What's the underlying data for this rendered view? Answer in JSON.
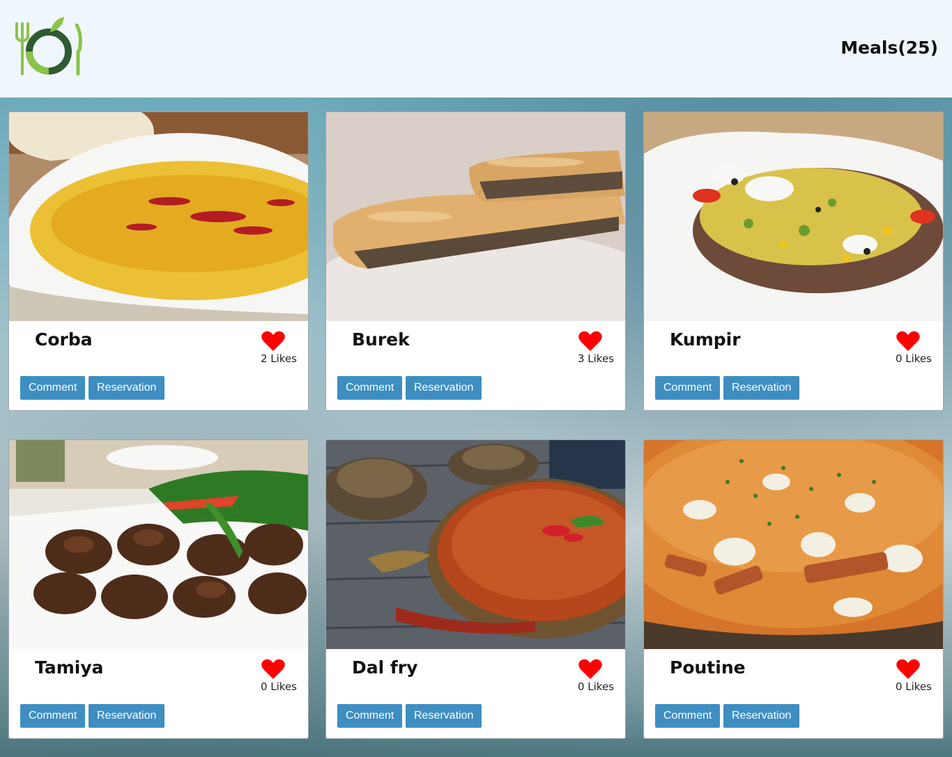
{
  "header": {
    "logo_icon": "plate-fork-knife-leaf-icon",
    "meals_count": "Meals(25)"
  },
  "cards": [
    {
      "name": "Corba",
      "likes": "2 Likes",
      "comment_label": "Comment",
      "reservation_label": "Reservation"
    },
    {
      "name": "Burek",
      "likes": "3 Likes",
      "comment_label": "Comment",
      "reservation_label": "Reservation"
    },
    {
      "name": "Kumpir",
      "likes": "0 Likes",
      "comment_label": "Comment",
      "reservation_label": "Reservation"
    },
    {
      "name": "Tamiya",
      "likes": "0 Likes",
      "comment_label": "Comment",
      "reservation_label": "Reservation"
    },
    {
      "name": "Dal fry",
      "likes": "0 Likes",
      "comment_label": "Comment",
      "reservation_label": "Reservation"
    },
    {
      "name": "Poutine",
      "likes": "0 Likes",
      "comment_label": "Comment",
      "reservation_label": "Reservation"
    }
  ],
  "colors": {
    "button": "#3e8ec2",
    "heart": "#ff0000",
    "header_bg": "#f0f7fc"
  }
}
